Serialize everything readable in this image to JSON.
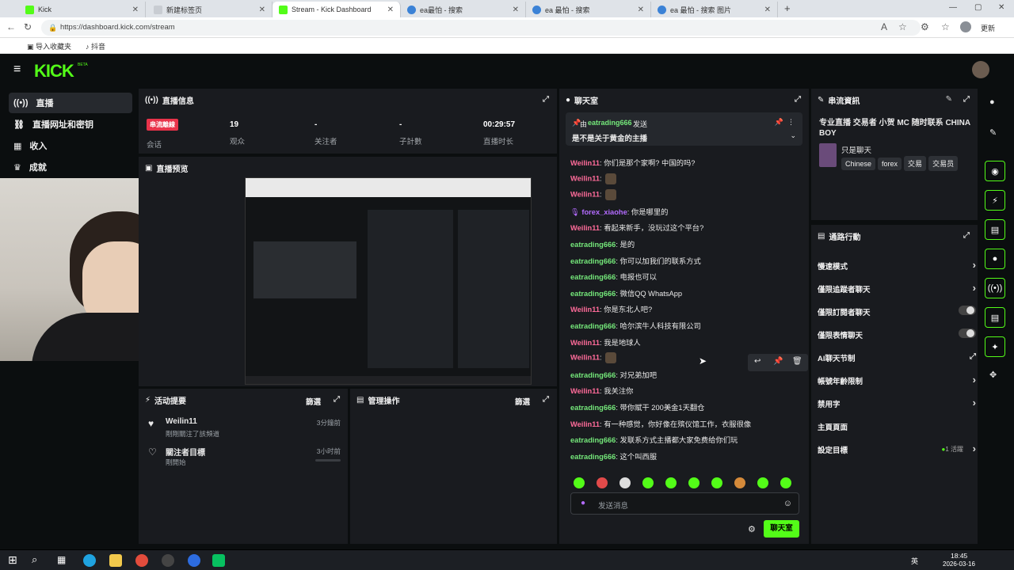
{
  "browser": {
    "tabs": [
      {
        "title": "Kick",
        "icon": "kick-favicon-icon"
      },
      {
        "title": "新建标签页",
        "icon": "page-favicon-icon"
      },
      {
        "title": "Stream - Kick Dashboard",
        "icon": "kick-favicon-icon"
      },
      {
        "title": "ea最怕 - 搜索",
        "icon": "search-favicon-icon"
      },
      {
        "title": "ea 最怕 - 搜索",
        "icon": "search-favicon-icon"
      },
      {
        "title": "ea 最怕 - 搜索 图片",
        "icon": "search-favicon-icon"
      }
    ],
    "url": "https://dashboard.kick.com/stream",
    "bookmarks": [
      "导入收藏夹",
      "抖音"
    ],
    "profile_label": "更新"
  },
  "app": {
    "logo": "KICK",
    "logo_badge": "BETA",
    "nav": [
      {
        "label": "直播",
        "icon": "broadcast-icon"
      },
      {
        "label": "直播网址和密钥",
        "icon": "link-icon"
      },
      {
        "label": "收入",
        "icon": "chart-icon"
      },
      {
        "label": "成就",
        "icon": "trophy-icon"
      }
    ]
  },
  "stream_info": {
    "title": "直播信息",
    "status_badge": "串流離線",
    "status_label": "会话",
    "stats": [
      {
        "value": "19",
        "label": "观众"
      },
      {
        "value": "-",
        "label": "关注者"
      },
      {
        "value": "-",
        "label": "子計數"
      },
      {
        "value": "00:29:57",
        "label": "直播时长"
      }
    ]
  },
  "preview": {
    "title": "直播预览"
  },
  "activity": {
    "title": "活动提要",
    "filter": "篩選",
    "items": [
      {
        "name": "Weilin11",
        "desc": "剛剛關注了該頻道",
        "time": "3分鐘前"
      },
      {
        "name": "關注者目標",
        "desc": "剛開始",
        "time": "3小时前"
      }
    ]
  },
  "mod_actions": {
    "title": "管理操作",
    "filter": "篩選"
  },
  "chat": {
    "title": "聊天室",
    "pinned_prefix": "由",
    "pinned_user": "eatrading666",
    "pinned_suffix": "发送",
    "pinned_text": "是不是关于黄金的主播",
    "messages": [
      {
        "user": "Weilin11",
        "color": "#ff6b9a",
        "text": "你们是那个家啊? 中国的吗?"
      },
      {
        "user": "Weilin11",
        "color": "#ff6b9a",
        "text": "",
        "emote": true
      },
      {
        "user": "Weilin11",
        "color": "#ff6b9a",
        "text": "",
        "emote": true
      },
      {
        "user": "forex_xiaohe",
        "color": "#b36bff",
        "text": "你是哪里的",
        "mic": true
      },
      {
        "user": "Weilin11",
        "color": "#ff6b9a",
        "text": "看起来新手，没玩过这个平台?"
      },
      {
        "user": "eatrading666",
        "color": "#74e77a",
        "text": "是的"
      },
      {
        "user": "eatrading666",
        "color": "#74e77a",
        "text": "你可以加我们的联系方式"
      },
      {
        "user": "eatrading666",
        "color": "#74e77a",
        "text": "电报也可以"
      },
      {
        "user": "eatrading666",
        "color": "#74e77a",
        "text": "微信QQ WhatsApp"
      },
      {
        "user": "Weilin11",
        "color": "#ff6b9a",
        "text": "你是东北人吧?"
      },
      {
        "user": "eatrading666",
        "color": "#74e77a",
        "text": "哈尔滨牛人科技有限公司"
      },
      {
        "user": "Weilin11",
        "color": "#ff6b9a",
        "text": "我是地球人"
      },
      {
        "user": "Weilin11",
        "color": "#ff6b9a",
        "text": "",
        "emote": true
      },
      {
        "user": "eatrading666",
        "color": "#74e77a",
        "text": "对兄弟加吧"
      },
      {
        "user": "Weilin11",
        "color": "#ff6b9a",
        "text": "我关注你"
      },
      {
        "user": "eatrading666",
        "color": "#74e77a",
        "text": "带你赋干 200美金1天翻仓"
      },
      {
        "user": "Weilin11",
        "color": "#ff6b9a",
        "text": "有一种感觉，你好像在殡仪馆工作，衣服很像"
      },
      {
        "user": "eatrading666",
        "color": "#74e77a",
        "text": "发联系方式主播都大家免费给你们玩"
      },
      {
        "user": "eatrading666",
        "color": "#74e77a",
        "text": "这个叫西服"
      }
    ],
    "input_placeholder": "发送消息",
    "send_button": "聊天室"
  },
  "stream_profile": {
    "title": "串流資訊",
    "stream_title": "专业直播 交易者 小贺 MC 随时联系 CHINA BOY",
    "category": "只是聊天",
    "tags": [
      "Chinese",
      "forex",
      "交易",
      "交易员"
    ]
  },
  "quick_actions": {
    "title": "通路行動",
    "items": [
      {
        "label": "慢速模式",
        "control": "chevron"
      },
      {
        "label": "僅限追蹤者聊天",
        "control": "chevron"
      },
      {
        "label": "僅限訂閱者聊天",
        "control": "toggle"
      },
      {
        "label": "僅限表情聊天",
        "control": "toggle"
      },
      {
        "label": "AI聊天节制",
        "control": "external"
      },
      {
        "label": "帳號年齡限制",
        "control": "chevron"
      },
      {
        "label": "禁用字",
        "control": "chevron"
      },
      {
        "label": "主頁頁面",
        "control": "none"
      },
      {
        "label": "設定目標",
        "control": "chevron",
        "badge": "1 活躍"
      }
    ]
  },
  "taskbar": {
    "time": "18:45",
    "date": "2026-03-16",
    "lang": "英"
  }
}
